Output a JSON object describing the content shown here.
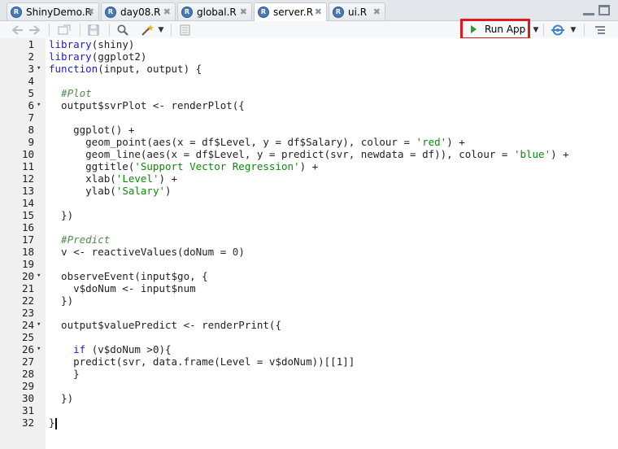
{
  "tabs": [
    {
      "label": "ShinyDemo.R",
      "active": false
    },
    {
      "label": "day08.R",
      "active": false
    },
    {
      "label": "global.R",
      "active": false
    },
    {
      "label": "server.R",
      "active": true
    },
    {
      "label": "ui.R",
      "active": false
    }
  ],
  "toolbar": {
    "run_app_label": "Run App",
    "icons": [
      "back-arrow-icon",
      "forward-arrow-icon",
      "show-in-window-icon",
      "save-icon",
      "search-icon",
      "magic-wand-icon",
      "compile-report-icon",
      "publish-icon",
      "outline-icon"
    ]
  },
  "colors": {
    "keyword": "#1c1cd6",
    "string": "#0b8a0b",
    "run_highlight": "#e01a1a",
    "run_play": "#2b9a3a"
  },
  "code_lines": [
    {
      "n": "1",
      "fold": false,
      "segs": [
        {
          "t": "library",
          "c": "kw"
        },
        {
          "t": "(shiny)",
          "c": ""
        }
      ]
    },
    {
      "n": "2",
      "fold": false,
      "segs": [
        {
          "t": "library",
          "c": "kw"
        },
        {
          "t": "(ggplot2)",
          "c": ""
        }
      ]
    },
    {
      "n": "3",
      "fold": true,
      "segs": [
        {
          "t": "function",
          "c": "kw"
        },
        {
          "t": "(input, output) {",
          "c": ""
        }
      ]
    },
    {
      "n": "4",
      "fold": false,
      "segs": []
    },
    {
      "n": "5",
      "fold": false,
      "segs": [
        {
          "t": "  #Plot",
          "c": "cm"
        }
      ]
    },
    {
      "n": "6",
      "fold": true,
      "segs": [
        {
          "t": "  output$svrPlot <- renderPlot({",
          "c": ""
        }
      ]
    },
    {
      "n": "7",
      "fold": false,
      "segs": []
    },
    {
      "n": "8",
      "fold": false,
      "segs": [
        {
          "t": "    ggplot() +",
          "c": ""
        }
      ]
    },
    {
      "n": "9",
      "fold": false,
      "segs": [
        {
          "t": "      geom_point(aes(x = df$Level, y = df$Salary), colour = ",
          "c": ""
        },
        {
          "t": "'red'",
          "c": "str"
        },
        {
          "t": ") +",
          "c": ""
        }
      ]
    },
    {
      "n": "10",
      "fold": false,
      "segs": [
        {
          "t": "      geom_line(aes(x = df$Level, y = predict(svr, newdata = df)), colour = ",
          "c": ""
        },
        {
          "t": "'blue'",
          "c": "str"
        },
        {
          "t": ") +",
          "c": ""
        }
      ]
    },
    {
      "n": "11",
      "fold": false,
      "segs": [
        {
          "t": "      ggtitle(",
          "c": ""
        },
        {
          "t": "'Support Vector Regression'",
          "c": "str"
        },
        {
          "t": ") +",
          "c": ""
        }
      ]
    },
    {
      "n": "12",
      "fold": false,
      "segs": [
        {
          "t": "      xlab(",
          "c": ""
        },
        {
          "t": "'Level'",
          "c": "str"
        },
        {
          "t": ") +",
          "c": ""
        }
      ]
    },
    {
      "n": "13",
      "fold": false,
      "segs": [
        {
          "t": "      ylab(",
          "c": ""
        },
        {
          "t": "'Salary'",
          "c": "str"
        },
        {
          "t": ")",
          "c": ""
        }
      ]
    },
    {
      "n": "14",
      "fold": false,
      "segs": []
    },
    {
      "n": "15",
      "fold": false,
      "segs": [
        {
          "t": "  })",
          "c": ""
        }
      ]
    },
    {
      "n": "16",
      "fold": false,
      "segs": []
    },
    {
      "n": "17",
      "fold": false,
      "segs": [
        {
          "t": "  #Predict",
          "c": "cm"
        }
      ]
    },
    {
      "n": "18",
      "fold": false,
      "segs": [
        {
          "t": "  v <- reactiveValues(doNum = ",
          "c": ""
        },
        {
          "t": "0",
          "c": "num"
        },
        {
          "t": ")",
          "c": ""
        }
      ]
    },
    {
      "n": "19",
      "fold": false,
      "segs": []
    },
    {
      "n": "20",
      "fold": true,
      "segs": [
        {
          "t": "  observeEvent(input$go, {",
          "c": ""
        }
      ]
    },
    {
      "n": "21",
      "fold": false,
      "segs": [
        {
          "t": "    v$doNum <- input$num",
          "c": ""
        }
      ]
    },
    {
      "n": "22",
      "fold": false,
      "segs": [
        {
          "t": "  })",
          "c": ""
        }
      ]
    },
    {
      "n": "23",
      "fold": false,
      "segs": []
    },
    {
      "n": "24",
      "fold": true,
      "segs": [
        {
          "t": "  output$valuePredict <- renderPrint({",
          "c": ""
        }
      ]
    },
    {
      "n": "25",
      "fold": false,
      "segs": []
    },
    {
      "n": "26",
      "fold": true,
      "segs": [
        {
          "t": "    ",
          "c": ""
        },
        {
          "t": "if",
          "c": "kw"
        },
        {
          "t": " (v$doNum >0){",
          "c": ""
        }
      ]
    },
    {
      "n": "27",
      "fold": false,
      "segs": [
        {
          "t": "    predict(svr, data.frame(Level = v$doNum))[[1]]",
          "c": ""
        }
      ]
    },
    {
      "n": "28",
      "fold": false,
      "segs": [
        {
          "t": "    }",
          "c": ""
        }
      ]
    },
    {
      "n": "29",
      "fold": false,
      "segs": []
    },
    {
      "n": "30",
      "fold": false,
      "segs": [
        {
          "t": "  })",
          "c": ""
        }
      ]
    },
    {
      "n": "31",
      "fold": false,
      "segs": []
    },
    {
      "n": "32",
      "fold": false,
      "segs": [
        {
          "t": "}",
          "c": ""
        }
      ],
      "cursor": true
    }
  ]
}
